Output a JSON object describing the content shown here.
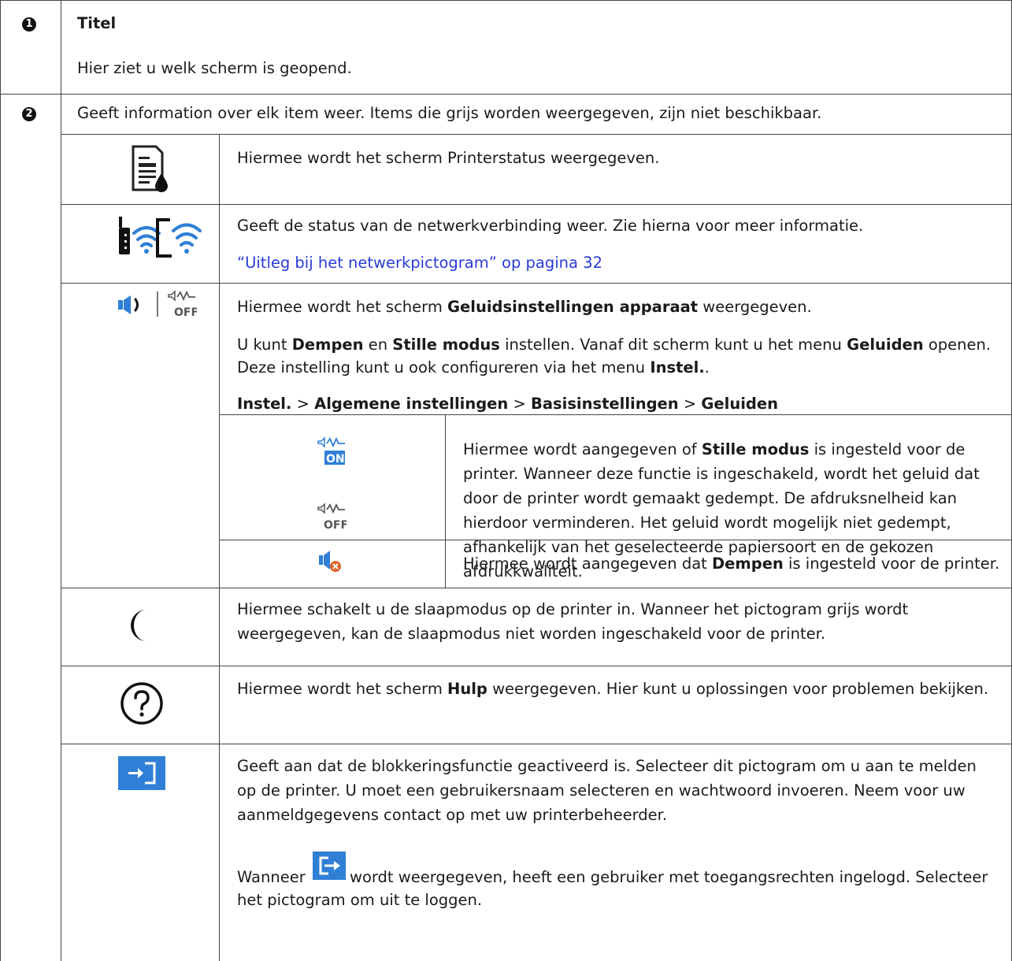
{
  "row1": {
    "marker": "1",
    "title": "Titel",
    "desc": "Hier ziet u welk scherm is geopend."
  },
  "row2": {
    "marker": "2",
    "intro": "Geeft information over elk item weer. Items die grijs worden weergegeven, zijn niet beschikbaar.",
    "printer_status": {
      "icon": "printer-status-icon",
      "desc": "Hiermee wordt het scherm Printerstatus weergegeven."
    },
    "network": {
      "icons": [
        "wifi-router-icon",
        "wifi-direct-icon"
      ],
      "desc": "Geeft de status van de netwerkverbinding weer. Zie hierna voor meer informatie.",
      "link": "“Uitleg bij het netwerkpictogram” op pagina 32"
    },
    "sound": {
      "icons": [
        "speaker-icon",
        "quiet-off-icon"
      ],
      "l1_a": "Hiermee wordt het scherm ",
      "l1_b": "Geluidsinstellingen apparaat",
      "l1_c": " weergegeven.",
      "l2_a": "U kunt ",
      "l2_b": "Dempen",
      "l2_c": " en ",
      "l2_d": "Stille modus",
      "l2_e": " instellen. Vanaf dit scherm kunt u het menu ",
      "l2_f": "Geluiden",
      "l2_g": " openen.",
      "l3_a": "Deze instelling kunt u ook configureren via het menu ",
      "l3_b": "Instel.",
      "l3_c": ".",
      "path_1": "Instel.",
      "path_2": "Algemene instellingen",
      "path_3": "Basisinstellingen",
      "path_4": "Geluiden",
      "sep": ">",
      "quiet_icons": [
        "quiet-on-icon",
        "quiet-off-icon"
      ],
      "quiet_a": "Hiermee wordt aangegeven of ",
      "quiet_b": "Stille modus",
      "quiet_c": " is ingesteld voor de printer. Wanneer deze functie is ingeschakeld, wordt het geluid dat door de printer wordt gemaakt gedempt. De afdruksnelheid kan hierdoor verminderen. Het geluid wordt mogelijk niet gedempt, afhankelijk van het geselecteerde papiersoort en de gekozen afdrukkwaliteit.",
      "mute_icon": "mute-icon",
      "mute_a": "Hiermee wordt aangegeven dat ",
      "mute_b": "Dempen",
      "mute_c": " is ingesteld voor de printer."
    },
    "sleep": {
      "icon": "moon-icon",
      "desc": "Hiermee schakelt u de slaapmodus op de printer in. Wanneer het pictogram grijs wordt weergegeven, kan de slaapmodus niet worden ingeschakeld voor de printer."
    },
    "help": {
      "icon": "help-icon",
      "a": "Hiermee wordt het scherm ",
      "b": "Hulp",
      "c": " weergegeven. Hier kunt u oplossingen voor problemen bekijken."
    },
    "login": {
      "icon": "login-icon",
      "desc": "Geeft aan dat de blokkeringsfunctie geactiveerd is. Selecteer dit pictogram om u aan te melden op de printer. U moet een gebruikersnaam selecteren en wachtwoord invoeren. Neem voor uw aanmeldgegevens contact op met uw printerbeheerder.",
      "w_a": "Wanneer",
      "logout_icon": "logout-icon",
      "w_b": "wordt weergegeven, heeft een gebruiker met toegangsrechten ingelogd. Selecteer",
      "w_c": "het pictogram om uit te loggen."
    }
  },
  "colors": {
    "accent_blue": "#2f7fd6",
    "link": "#2a3bd6",
    "border": "#444444"
  }
}
